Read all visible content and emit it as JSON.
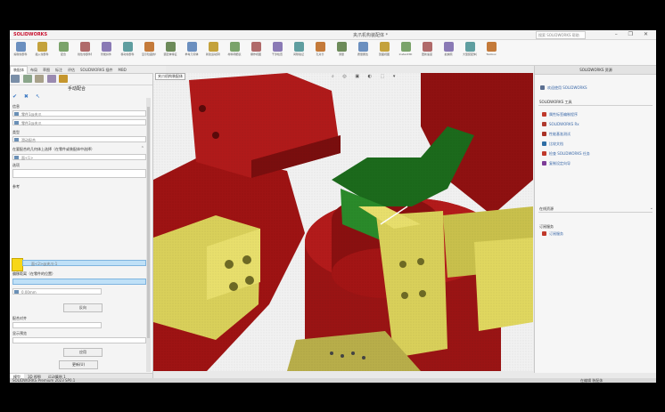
{
  "app": {
    "brand": "SOLIDWORKS",
    "title": "夹爪机构装配体 *",
    "search_placeholder": "搜索 SOLIDWORKS 帮助",
    "window_buttons": "– ❐ ✕"
  },
  "ribbon": {
    "items": [
      "编辑零部件",
      "插入零部件",
      "配合",
      "线性零部件阵列",
      "智能扣件",
      "移动零部件",
      "显示隐藏的零部件",
      "装配体特征",
      "参考几何体",
      "新建运动算例",
      "材料明细表",
      "爆炸视图",
      "干涉检查",
      "间隙验证",
      "孔对齐",
      "测量",
      "质量属性",
      "剖面视图",
      "Instant3D",
      "更新速度",
      "拍快照",
      "大型装配体设置",
      "Toolbox"
    ]
  },
  "command_tabs": [
    "装配体",
    "布局",
    "草图",
    "标注",
    "评估",
    "SOLIDWORKS 插件",
    "MBD"
  ],
  "left_panel": {
    "title": "手动配合",
    "confirm_icons": "✔ ✖ ↖",
    "sec_message": "信息",
    "field_1": "零件1@夹爪",
    "field_2": "零件2@夹爪",
    "sec_type": "类型",
    "field_type": "滑动配合",
    "sec_selection": "在要配合的几何体上选择（在零件或装配体中选择）",
    "field_sel": "面<1>",
    "sec_options": "选项",
    "sec_reference": "参考",
    "field_highlight": "面<2>@夹爪-1",
    "sec_offset": "偏移距离（在零件的位置）",
    "field_offset": "0.00mm",
    "btn_flip": "反向",
    "sec_align": "配合对齐",
    "btn_apply": "应用",
    "btn_update": "更新(U)",
    "sec_hint": "显示预览",
    "sec_bottom": "选项",
    "sec_bottom2": "高级"
  },
  "viewport": {
    "file_tab": "夹爪机构装配体",
    "toolbar_glyphs": "⌕ ◎ ▣ ◐ ⬚ ▾"
  },
  "right_panel": {
    "title": "SOLIDWORKS 资源",
    "home": "欢迎使用 SOLIDWORKS",
    "sec_tools": "SOLIDWORKS 工具",
    "tools": [
      "属性标签编制程序",
      "SOLIDWORKS Rx",
      "性能基准测试",
      "比较文档",
      "检查 SOLIDWORKS 任务",
      "复制设定向导"
    ],
    "sec_community": "在线资源",
    "sec_subscription": "订阅服务",
    "subscription_items": [
      "订阅服务"
    ]
  },
  "bottom_tabs": [
    "模型",
    "3D 视图",
    "运动算例 1"
  ],
  "status": {
    "left": "SOLIDWORKS Premium 2023 SP0.1",
    "right": "在编辑 装配体"
  },
  "colors": {
    "red_part": "#9e1313",
    "green_part": "#1c6a1c",
    "yellow_part": "#d9d05a",
    "accent": "#c8102e"
  }
}
